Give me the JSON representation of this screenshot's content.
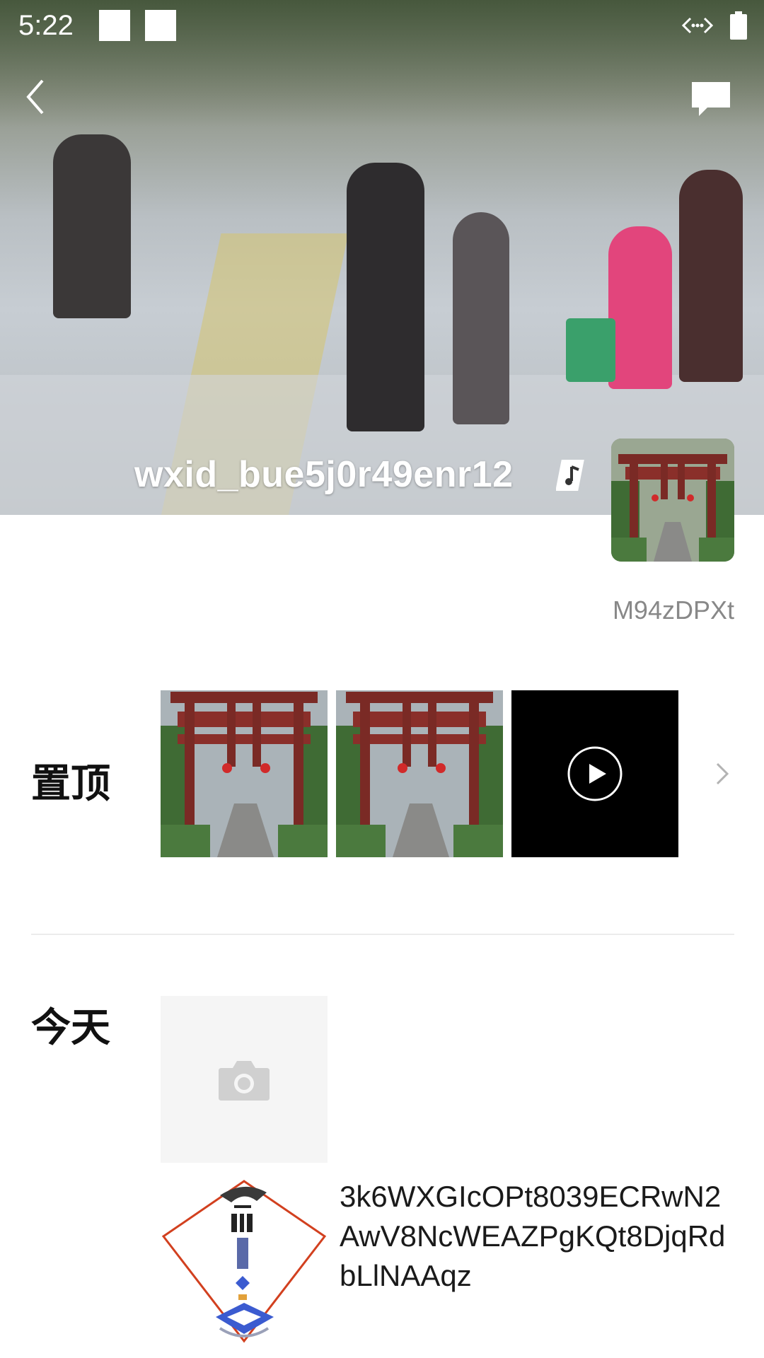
{
  "status_bar": {
    "time": "5:22",
    "icons": [
      "notification-square",
      "notification-square",
      "network-arrows-icon",
      "battery-icon"
    ]
  },
  "profile": {
    "username": "wxid_bue5j0r49enr12",
    "music_icon": "music-note-icon",
    "signature": "M94zDPXt"
  },
  "sections": {
    "pinned_label": "置顶",
    "today_label": "今天"
  },
  "today_post": {
    "text": "3k6WXGIcOPt8039ECRwN2AwV8NcWEAZPgKQt8DjqRdbLlNAAqz"
  },
  "colors": {
    "gate_red": "#8a2f2a",
    "foliage": "#3f6b34",
    "label": "#111111",
    "muted": "#888888"
  }
}
